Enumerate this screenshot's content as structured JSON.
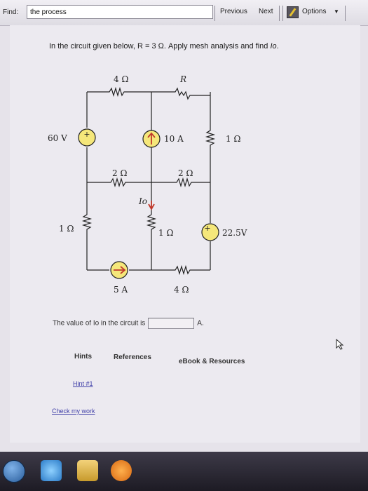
{
  "findbar": {
    "label": "Find:",
    "query": "the process",
    "previous": "Previous",
    "next": "Next",
    "options": "Options"
  },
  "question": {
    "prefix": "In the circuit given below, R = 3 Ω. Apply mesh analysis and find ",
    "var": "Io",
    "suffix": "."
  },
  "circuit": {
    "r_top_left": "4 Ω",
    "r_top_right": "R",
    "src_60v": "60 V",
    "src_10a": "10 A",
    "r_right_1": "1 Ω",
    "r_mid_left": "2 Ω",
    "r_mid_right": "2 Ω",
    "io_label": "Io",
    "r_left_1": "1 Ω",
    "r_center_1": "1 Ω",
    "src_22v": "22.5V",
    "src_5a": "5 A",
    "r_bottom": "4 Ω"
  },
  "answer": {
    "prefix": "The value of Io in the circuit is",
    "unit": "A."
  },
  "tabs": {
    "hints": "Hints",
    "references": "References",
    "ebook": "eBook & Resources"
  },
  "links": {
    "hint1": "Hint #1",
    "check": "Check my work"
  }
}
